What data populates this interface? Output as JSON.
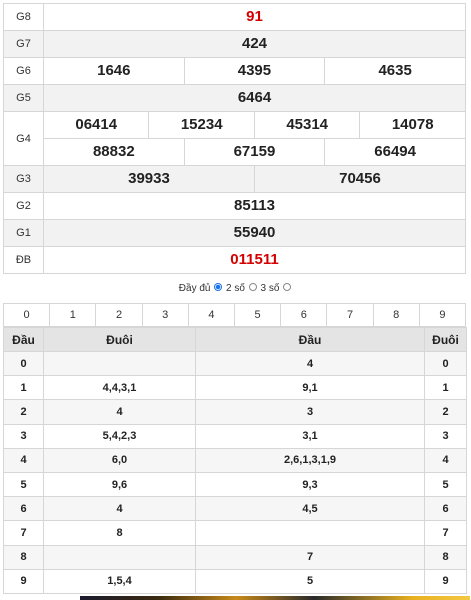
{
  "prizes": {
    "g8": {
      "label": "G8",
      "values": [
        "91"
      ]
    },
    "g7": {
      "label": "G7",
      "values": [
        "424"
      ]
    },
    "g6": {
      "label": "G6",
      "values": [
        "1646",
        "4395",
        "4635"
      ]
    },
    "g5": {
      "label": "G5",
      "values": [
        "6464"
      ]
    },
    "g4": {
      "label": "G4",
      "row1": [
        "06414",
        "15234",
        "45314",
        "14078"
      ],
      "row2": [
        "88832",
        "67159",
        "66494"
      ]
    },
    "g3": {
      "label": "G3",
      "values": [
        "39933",
        "70456"
      ]
    },
    "g2": {
      "label": "G2",
      "values": [
        "85113"
      ]
    },
    "g1": {
      "label": "G1",
      "values": [
        "55940"
      ]
    },
    "db": {
      "label": "ĐB",
      "values": [
        "011511"
      ]
    }
  },
  "options": {
    "full_label": "Đầy đủ",
    "two_label": "2 số",
    "three_label": "3 số",
    "selected": "full"
  },
  "digits": [
    "0",
    "1",
    "2",
    "3",
    "4",
    "5",
    "6",
    "7",
    "8",
    "9"
  ],
  "loto": {
    "headers": [
      "Đầu",
      "Đuôi",
      "Đầu",
      "Đuôi"
    ],
    "rows": [
      {
        "dau": "0",
        "duoi": "",
        "dau2": "4",
        "duoi2": "0"
      },
      {
        "dau": "1",
        "duoi": "4,4,3,1",
        "dau2": "9,1",
        "duoi2": "1"
      },
      {
        "dau": "2",
        "duoi": "4",
        "dau2": "3",
        "duoi2": "2"
      },
      {
        "dau": "3",
        "duoi": "5,4,2,3",
        "dau2": "3,1",
        "duoi2": "3"
      },
      {
        "dau": "4",
        "duoi": "6,0",
        "dau2": "2,6,1,3,1,9",
        "duoi2": "4"
      },
      {
        "dau": "5",
        "duoi": "9,6",
        "dau2": "9,3",
        "duoi2": "5"
      },
      {
        "dau": "6",
        "duoi": "4",
        "dau2": "4,5",
        "duoi2": "6"
      },
      {
        "dau": "7",
        "duoi": "8",
        "dau2": "",
        "duoi2": "7"
      },
      {
        "dau": "8",
        "duoi": "",
        "dau2": "7",
        "duoi2": "8"
      },
      {
        "dau": "9",
        "duoi": "1,5,4",
        "dau2": "5",
        "duoi2": "9"
      }
    ]
  },
  "colors": {
    "special": "#d40000",
    "accent": "#1a73e8"
  }
}
